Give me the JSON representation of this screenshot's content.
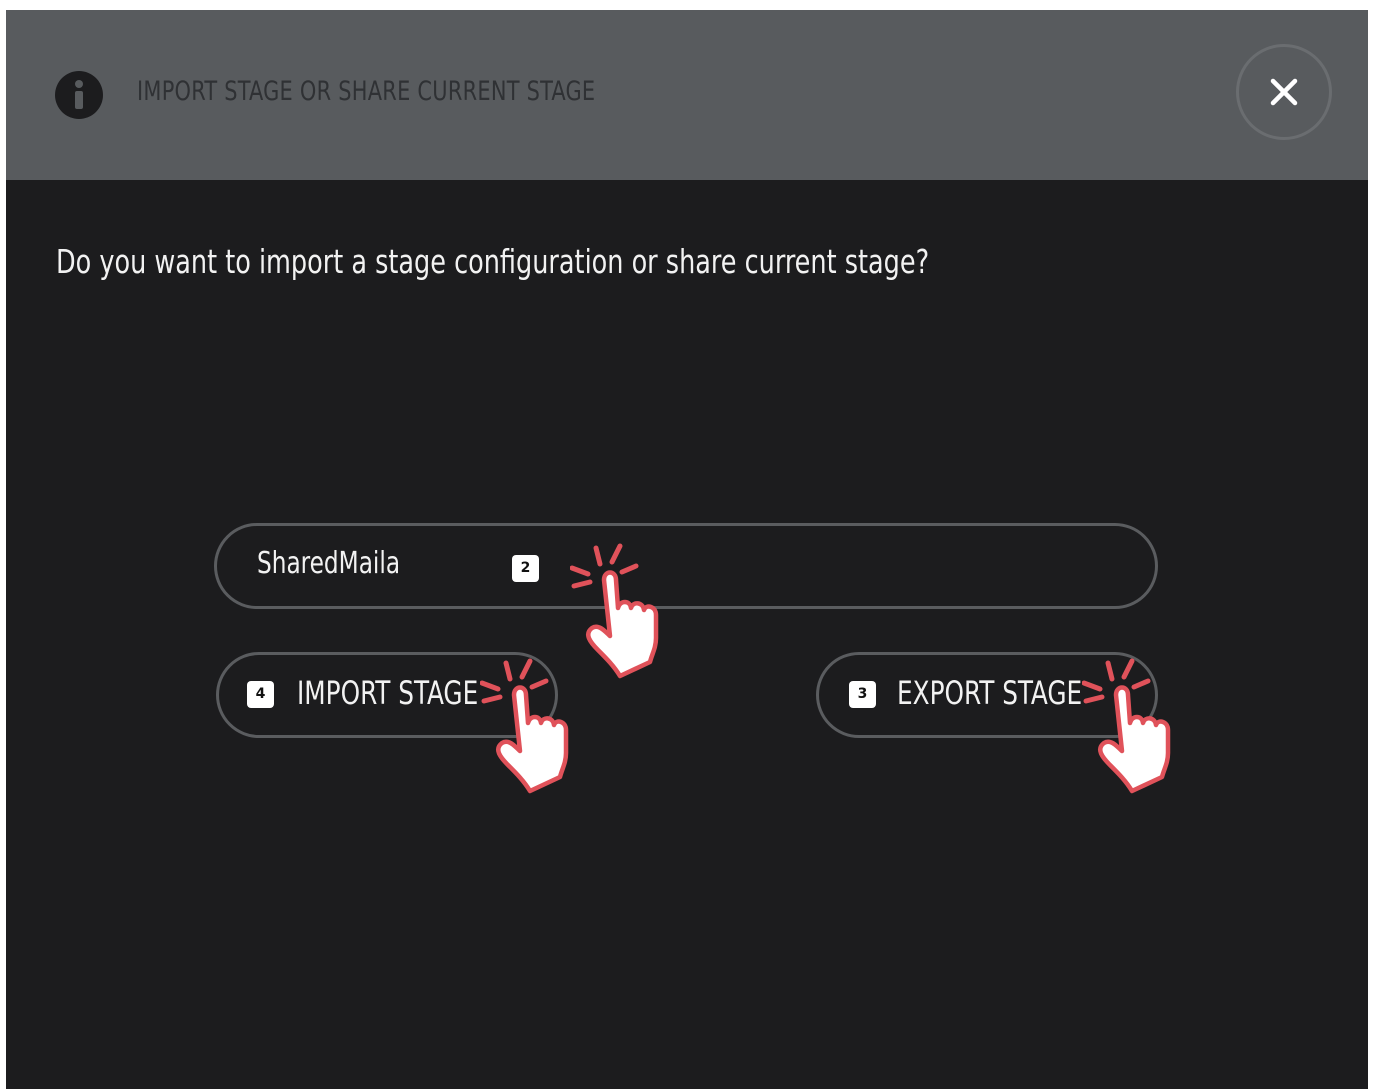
{
  "dialog": {
    "title": "IMPORT STAGE OR SHARE CURRENT STAGE",
    "question": "Do you want to import a stage configuration or share current stage?",
    "close_icon": "close-icon",
    "info_icon": "info-icon"
  },
  "stage_name": {
    "value": "SharedMaila",
    "step": "2"
  },
  "import_button": {
    "label": "IMPORT STAGE",
    "step": "4"
  },
  "export_button": {
    "label": "EXPORT STAGE",
    "step": "3"
  },
  "colors": {
    "header_bg": "#585b5e",
    "body_bg": "#1c1c1e",
    "outline": "#5a5c5f",
    "tap_accent": "#e0525a"
  }
}
